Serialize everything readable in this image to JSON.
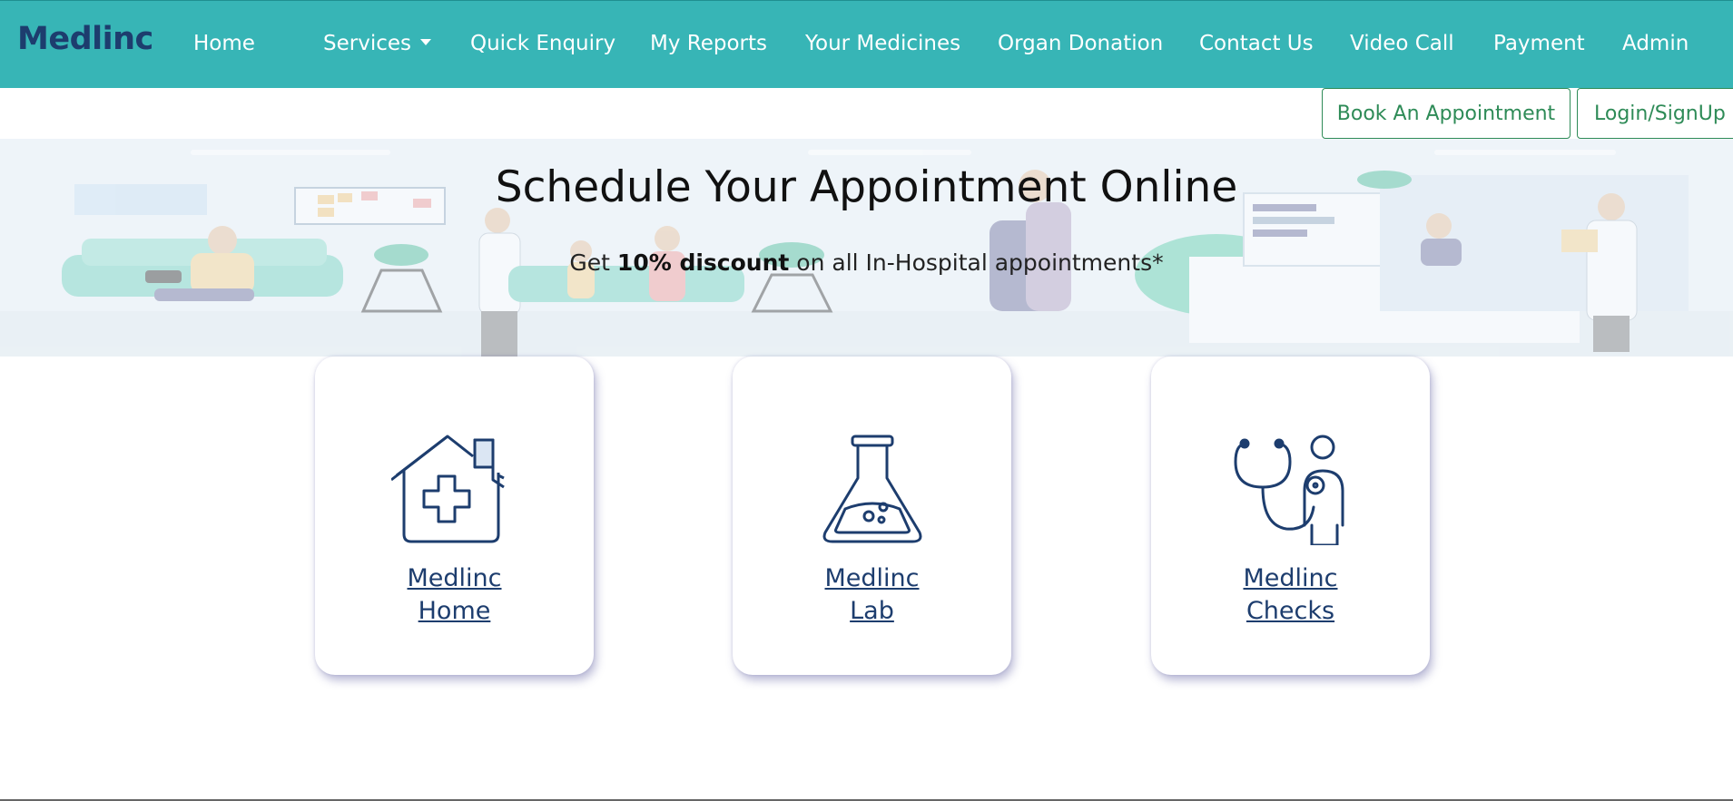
{
  "navbar": {
    "brand": "Medlinc",
    "items": [
      {
        "label": "Home"
      },
      {
        "label": "Services"
      },
      {
        "label": "Quick Enquiry"
      },
      {
        "label": "My Reports"
      },
      {
        "label": "Your Medicines"
      },
      {
        "label": "Organ Donation"
      },
      {
        "label": "Contact Us"
      },
      {
        "label": "Video Call"
      },
      {
        "label": "Payment"
      },
      {
        "label": "Admin"
      }
    ]
  },
  "actions": {
    "book_label": "Book An Appointment",
    "login_label": "Login/SignUp"
  },
  "banner": {
    "title": "Schedule Your Appointment Online",
    "sub_prefix": "Get ",
    "sub_bold": "10% discount",
    "sub_suffix": " on all In-Hospital appointments*"
  },
  "cards": [
    {
      "icon": "home-medical-icon",
      "line1": "Medlinc",
      "line2": "Home"
    },
    {
      "icon": "lab-flask-icon",
      "line1": "Medlinc",
      "line2": "Lab"
    },
    {
      "icon": "stethoscope-checkup-icon",
      "line1": "Medlinc",
      "line2": "Checks"
    }
  ],
  "colors": {
    "navbar": "#37b5b6",
    "brand": "#1d3d6e",
    "button_border": "#2e8b57",
    "icon_stroke": "#1d3d6e"
  }
}
